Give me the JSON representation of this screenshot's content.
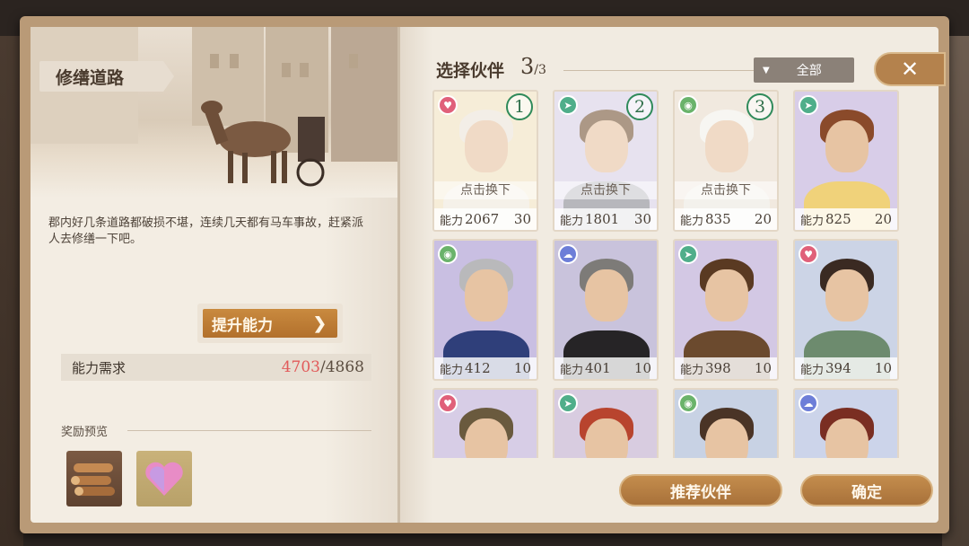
{
  "left": {
    "title": "修缮道路",
    "description": "郡内好几条道路都破损不堪，连续几天都有马车事故，赶紧派人去修缮一下吧。",
    "upgrade_label": "提升能力",
    "requirement": {
      "label": "能力需求",
      "current": "4703",
      "separator": "/",
      "target": "4868"
    },
    "reward_title": "奖励预览",
    "rewards": [
      {
        "icon": "wood-logs-icon"
      },
      {
        "icon": "heart-gem-icon"
      }
    ]
  },
  "right": {
    "title": "选择伙伴",
    "selected": "3",
    "max": "/3",
    "filter_label": "全部",
    "close_icon": "close-x-icon",
    "swap_label": "点击换下",
    "power_label": "能力",
    "cards": [
      {
        "type": "heart",
        "order": "1",
        "power": "2067",
        "level": "30",
        "selected": true
      },
      {
        "type": "run",
        "order": "2",
        "power": "1801",
        "level": "30",
        "selected": true
      },
      {
        "type": "eye",
        "order": "3",
        "power": "835",
        "level": "20",
        "selected": true
      },
      {
        "type": "run",
        "order": "",
        "power": "825",
        "level": "20",
        "selected": false
      },
      {
        "type": "eye",
        "order": "",
        "power": "412",
        "level": "10",
        "selected": false
      },
      {
        "type": "ghost",
        "order": "",
        "power": "401",
        "level": "10",
        "selected": false
      },
      {
        "type": "run",
        "order": "",
        "power": "398",
        "level": "10",
        "selected": false
      },
      {
        "type": "heart",
        "order": "",
        "power": "394",
        "level": "10",
        "selected": false
      },
      {
        "type": "heart",
        "order": "",
        "power": "",
        "level": "",
        "selected": false
      },
      {
        "type": "run",
        "order": "",
        "power": "",
        "level": "",
        "selected": false
      },
      {
        "type": "eye",
        "order": "",
        "power": "",
        "level": "",
        "selected": false
      },
      {
        "type": "ghost",
        "order": "",
        "power": "",
        "level": "",
        "selected": false
      }
    ],
    "recommend_label": "推荐伙伴",
    "confirm_label": "确定"
  },
  "colors": {
    "accent": "#b2702c",
    "requirement_current": "#e25a5a",
    "page": "#f1ebe1"
  }
}
